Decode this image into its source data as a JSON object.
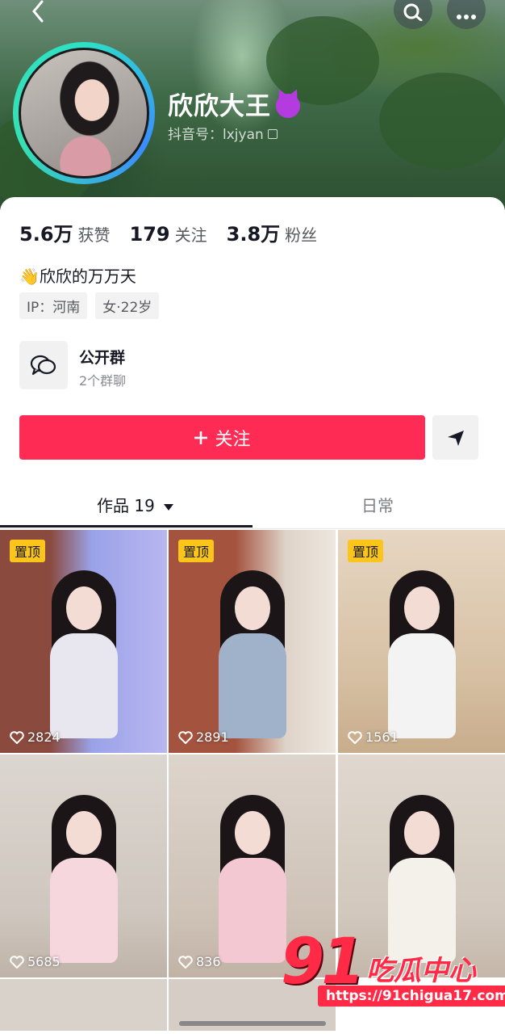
{
  "header": {
    "back_icon": "chevron-left-icon",
    "search_icon": "search-icon",
    "more_icon": "more-dots-icon"
  },
  "profile": {
    "nickname": "欣欣大王",
    "badge_icon": "devil-emoji-icon",
    "douyin_id_label": "抖音号：",
    "douyin_id": "lxjyan",
    "stats": [
      {
        "value": "5.6万",
        "label": "获赞"
      },
      {
        "value": "179",
        "label": "关注"
      },
      {
        "value": "3.8万",
        "label": "粉丝"
      }
    ],
    "bio": "👋欣欣的万万天",
    "tags": [
      "IP：河南",
      "女·22岁"
    ]
  },
  "group_chat": {
    "title": "公开群",
    "subtitle": "2个群聊"
  },
  "actions": {
    "follow_label": "关注",
    "follow_color": "#fe2c55"
  },
  "tabs": {
    "works_label": "作品 19",
    "daily_label": "日常"
  },
  "grid": {
    "pin_label": "置顶",
    "items": [
      {
        "likes": "2824",
        "pinned": true
      },
      {
        "likes": "2891",
        "pinned": true
      },
      {
        "likes": "1561",
        "pinned": true
      },
      {
        "likes": "5685",
        "pinned": false
      },
      {
        "likes": "836",
        "pinned": false
      },
      {
        "likes": "",
        "pinned": false
      }
    ]
  },
  "watermark": {
    "logo_number": "91",
    "logo_text": "吃瓜中心",
    "url": "https://91chigua17.com"
  }
}
